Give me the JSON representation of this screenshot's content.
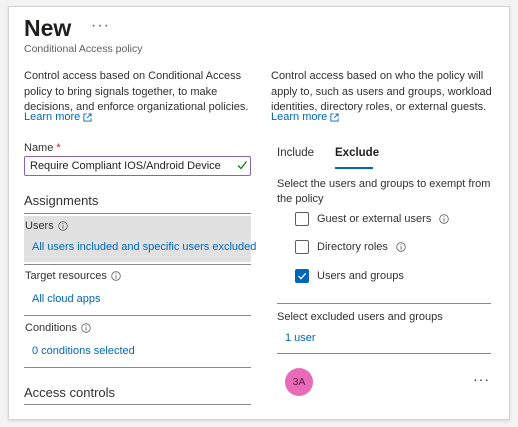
{
  "header": {
    "title": "New",
    "more_label": "···",
    "subtitle": "Conditional Access policy"
  },
  "left": {
    "description": "Control access based on Conditional Access policy to bring signals together, to make decisions, and enforce organizational policies.",
    "learn_more": "Learn more",
    "name_label": "Name",
    "required_marker": "*",
    "name_value": "Require Compliant IOS/Android Device",
    "assignments_heading": "Assignments",
    "users_label": "Users",
    "users_value": "All users included and specific users excluded",
    "target_label": "Target resources",
    "target_value": "All cloud apps",
    "conditions_label": "Conditions",
    "conditions_value": "0 conditions selected",
    "access_controls_heading": "Access controls"
  },
  "right": {
    "description": "Control access based on who the policy will apply to, such as users and groups, workload identities, directory roles, or external guests.",
    "learn_more": "Learn more",
    "tabs": [
      "Include",
      "Exclude"
    ],
    "active_tab": "Exclude",
    "exempt_text": "Select the users and groups to exempt from the policy",
    "options": [
      {
        "label": "Guest or external users",
        "checked": false,
        "info": true
      },
      {
        "label": "Directory roles",
        "checked": false,
        "info": true
      },
      {
        "label": "Users and groups",
        "checked": true,
        "info": false
      }
    ],
    "excluded_label": "Select excluded users and groups",
    "excluded_count": "1 user",
    "avatar_initials": "3A",
    "row_more": "···"
  },
  "colors": {
    "accent": "#0067b8",
    "avatar": "#e86ab8",
    "input_focus": "#8764b8",
    "valid_check": "#107c10",
    "required": "#a4262c"
  }
}
